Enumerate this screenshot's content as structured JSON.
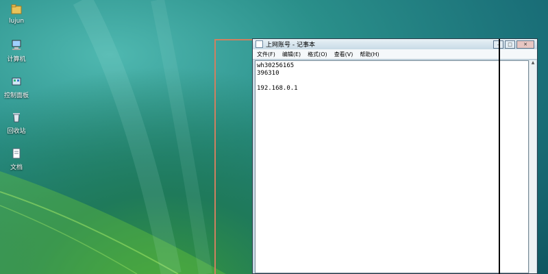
{
  "desktop": {
    "icons": [
      {
        "label": "lujun",
        "icon": "folder-icon"
      },
      {
        "label": "计算机",
        "icon": "computer-icon"
      },
      {
        "label": "控制面板",
        "icon": "control-panel-icon"
      },
      {
        "label": "回收站",
        "icon": "recycle-bin-icon"
      },
      {
        "label": "文档",
        "icon": "document-icon"
      }
    ]
  },
  "window": {
    "title": "上网账号 - 记事本",
    "buttons": {
      "minimize": "–",
      "maximize": "□",
      "close": "✕"
    },
    "menu": [
      "文件(F)",
      "编辑(E)",
      "格式(O)",
      "查看(V)",
      "帮助(H)"
    ],
    "content_lines": [
      "wh30256165",
      "396310",
      "",
      "192.168.0.1"
    ]
  }
}
